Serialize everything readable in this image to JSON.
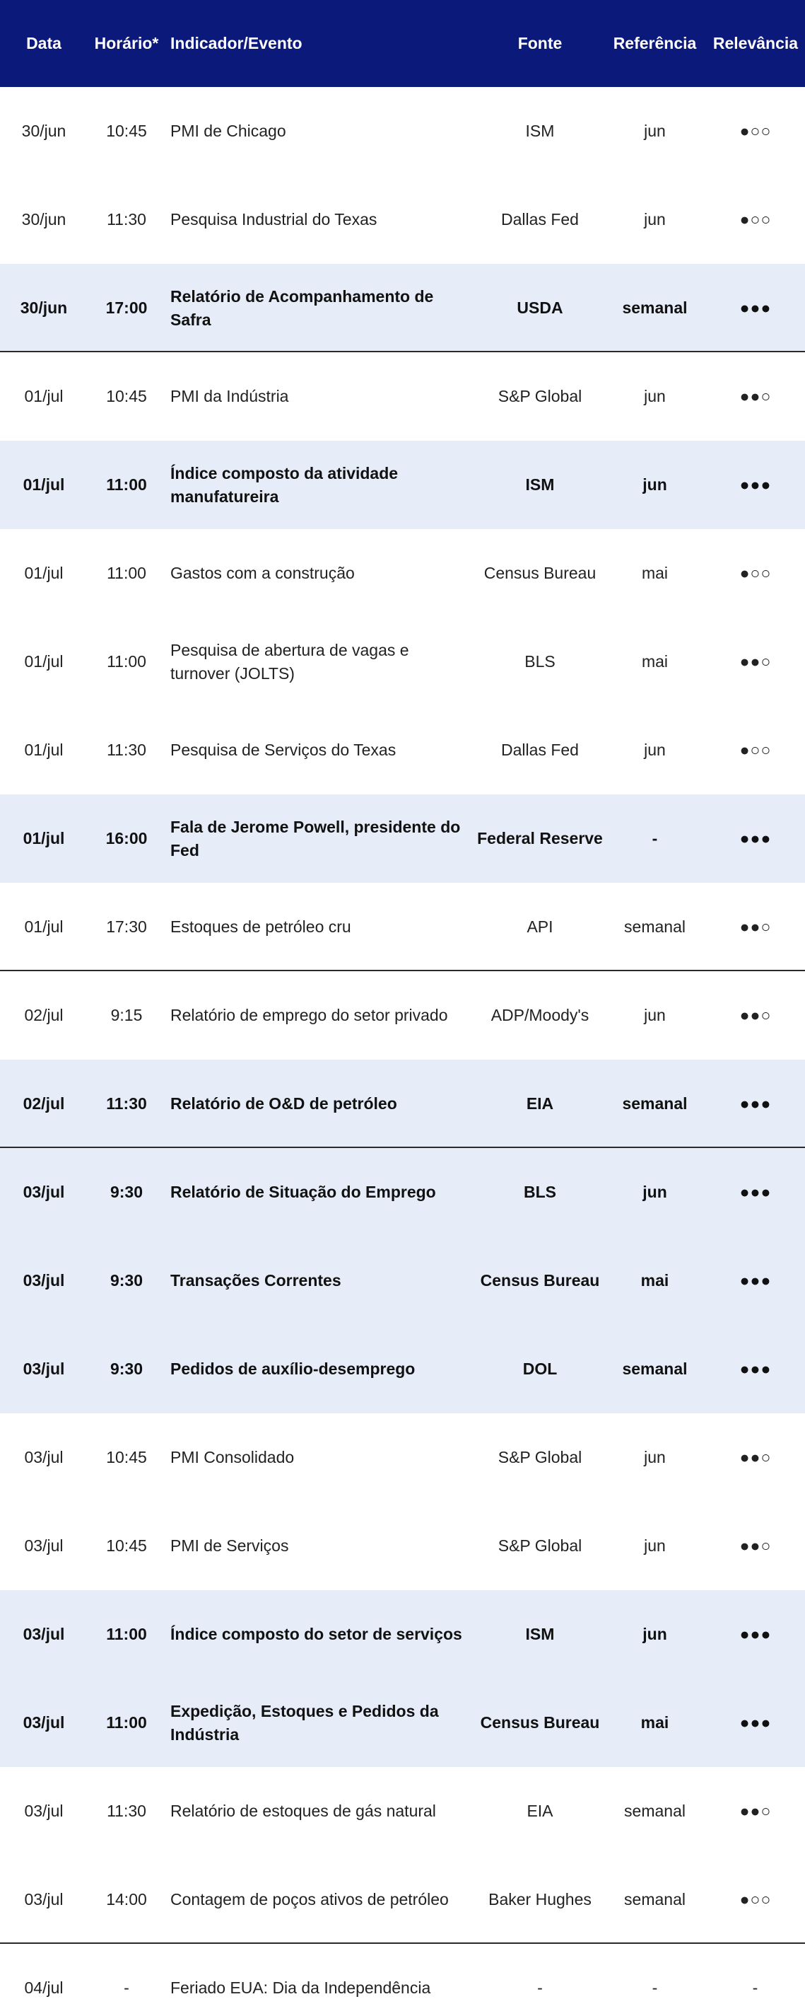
{
  "header": {
    "date": "Data",
    "time": "Horário*",
    "event": "Indicador/Evento",
    "source": "Fonte",
    "reference": "Referência",
    "relevance": "Relevância"
  },
  "rows": [
    {
      "date": "30/jun",
      "time": "10:45",
      "event": "PMI de Chicago",
      "source": "ISM",
      "reference": "jun",
      "relevance": "●○○",
      "highlight": false,
      "separator_after": false
    },
    {
      "date": "30/jun",
      "time": "11:30",
      "event": "Pesquisa Industrial do Texas",
      "source": "Dallas Fed",
      "reference": "jun",
      "relevance": "●○○",
      "highlight": false,
      "separator_after": false
    },
    {
      "date": "30/jun",
      "time": "17:00",
      "event": "Relatório de Acompanhamento de Safra",
      "source": "USDA",
      "reference": "semanal",
      "relevance": "●●●",
      "highlight": true,
      "separator_after": true
    },
    {
      "date": "01/jul",
      "time": "10:45",
      "event": "PMI da Indústria",
      "source": "S&P Global",
      "reference": "jun",
      "relevance": "●●○",
      "highlight": false,
      "separator_after": false
    },
    {
      "date": "01/jul",
      "time": "11:00",
      "event": "Índice composto da atividade manufatureira",
      "source": "ISM",
      "reference": "jun",
      "relevance": "●●●",
      "highlight": true,
      "separator_after": false
    },
    {
      "date": "01/jul",
      "time": "11:00",
      "event": "Gastos com a construção",
      "source": "Census Bureau",
      "reference": "mai",
      "relevance": "●○○",
      "highlight": false,
      "separator_after": false
    },
    {
      "date": "01/jul",
      "time": "11:00",
      "event": "Pesquisa de abertura de vagas e turnover (JOLTS)",
      "source": "BLS",
      "reference": "mai",
      "relevance": "●●○",
      "highlight": false,
      "separator_after": false
    },
    {
      "date": "01/jul",
      "time": "11:30",
      "event": "Pesquisa de Serviços do Texas",
      "source": "Dallas Fed",
      "reference": "jun",
      "relevance": "●○○",
      "highlight": false,
      "separator_after": false
    },
    {
      "date": "01/jul",
      "time": "16:00",
      "event": "Fala de Jerome Powell, presidente do Fed",
      "source": "Federal Reserve",
      "reference": "-",
      "relevance": "●●●",
      "highlight": true,
      "separator_after": false
    },
    {
      "date": "01/jul",
      "time": "17:30",
      "event": "Estoques de petróleo cru",
      "source": "API",
      "reference": "semanal",
      "relevance": "●●○",
      "highlight": false,
      "separator_after": true
    },
    {
      "date": "02/jul",
      "time": "9:15",
      "event": "Relatório de emprego do setor privado",
      "source": "ADP/Moody's",
      "reference": "jun",
      "relevance": "●●○",
      "highlight": false,
      "separator_after": false
    },
    {
      "date": "02/jul",
      "time": "11:30",
      "event": "Relatório de O&D de petróleo",
      "source": "EIA",
      "reference": "semanal",
      "relevance": "●●●",
      "highlight": true,
      "separator_after": true
    },
    {
      "date": "03/jul",
      "time": "9:30",
      "event": "Relatório de Situação do Emprego",
      "source": "BLS",
      "reference": "jun",
      "relevance": "●●●",
      "highlight": true,
      "separator_after": false
    },
    {
      "date": "03/jul",
      "time": "9:30",
      "event": "Transações Correntes",
      "source": "Census Bureau",
      "reference": "mai",
      "relevance": "●●●",
      "highlight": true,
      "separator_after": false
    },
    {
      "date": "03/jul",
      "time": "9:30",
      "event": "Pedidos de auxílio-desemprego",
      "source": "DOL",
      "reference": "semanal",
      "relevance": "●●●",
      "highlight": true,
      "separator_after": false
    },
    {
      "date": "03/jul",
      "time": "10:45",
      "event": "PMI Consolidado",
      "source": "S&P Global",
      "reference": "jun",
      "relevance": "●●○",
      "highlight": false,
      "separator_after": false
    },
    {
      "date": "03/jul",
      "time": "10:45",
      "event": "PMI de Serviços",
      "source": "S&P Global",
      "reference": "jun",
      "relevance": "●●○",
      "highlight": false,
      "separator_after": false
    },
    {
      "date": "03/jul",
      "time": "11:00",
      "event": "Índice composto do setor de serviços",
      "source": "ISM",
      "reference": "jun",
      "relevance": "●●●",
      "highlight": true,
      "separator_after": false
    },
    {
      "date": "03/jul",
      "time": "11:00",
      "event": "Expedição, Estoques e Pedidos da Indústria",
      "source": "Census Bureau",
      "reference": "mai",
      "relevance": "●●●",
      "highlight": true,
      "separator_after": false
    },
    {
      "date": "03/jul",
      "time": "11:30",
      "event": "Relatório de estoques de gás natural",
      "source": "EIA",
      "reference": "semanal",
      "relevance": "●●○",
      "highlight": false,
      "separator_after": false
    },
    {
      "date": "03/jul",
      "time": "14:00",
      "event": "Contagem de poços ativos de petróleo",
      "source": "Baker Hughes",
      "reference": "semanal",
      "relevance": "●○○",
      "highlight": false,
      "separator_after": true
    },
    {
      "date": "04/jul",
      "time": "-",
      "event": "Feriado EUA: Dia da Independência",
      "source": "-",
      "reference": "-",
      "relevance": "-",
      "highlight": false,
      "separator_after": false
    }
  ]
}
